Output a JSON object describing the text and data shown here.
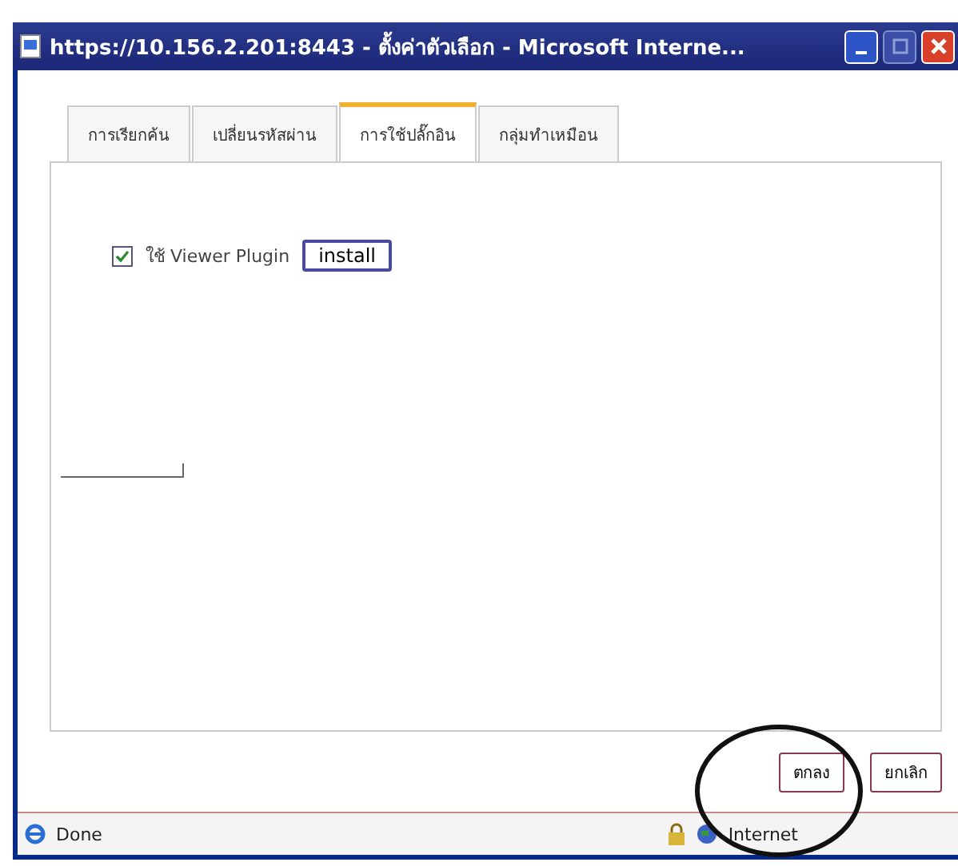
{
  "window": {
    "title": "https://10.156.2.201:8443 - ตั้งค่าตัวเลือก - Microsoft Interne..."
  },
  "tabs": [
    {
      "label": "การเรียกค้น",
      "selected": false
    },
    {
      "label": "เปลี่ยนรหัสผ่าน",
      "selected": false
    },
    {
      "label": "การใช้ปลั๊กอิน",
      "selected": true
    },
    {
      "label": "กลุ่มทำเหมือน",
      "selected": false
    }
  ],
  "plugin_option": {
    "label": "ใช้ Viewer Plugin",
    "checked": true,
    "button": "install"
  },
  "buttons": [
    "ตกลง",
    "ยกเลิก"
  ],
  "status_bar": {
    "status": "Done",
    "zone": "Internet"
  }
}
